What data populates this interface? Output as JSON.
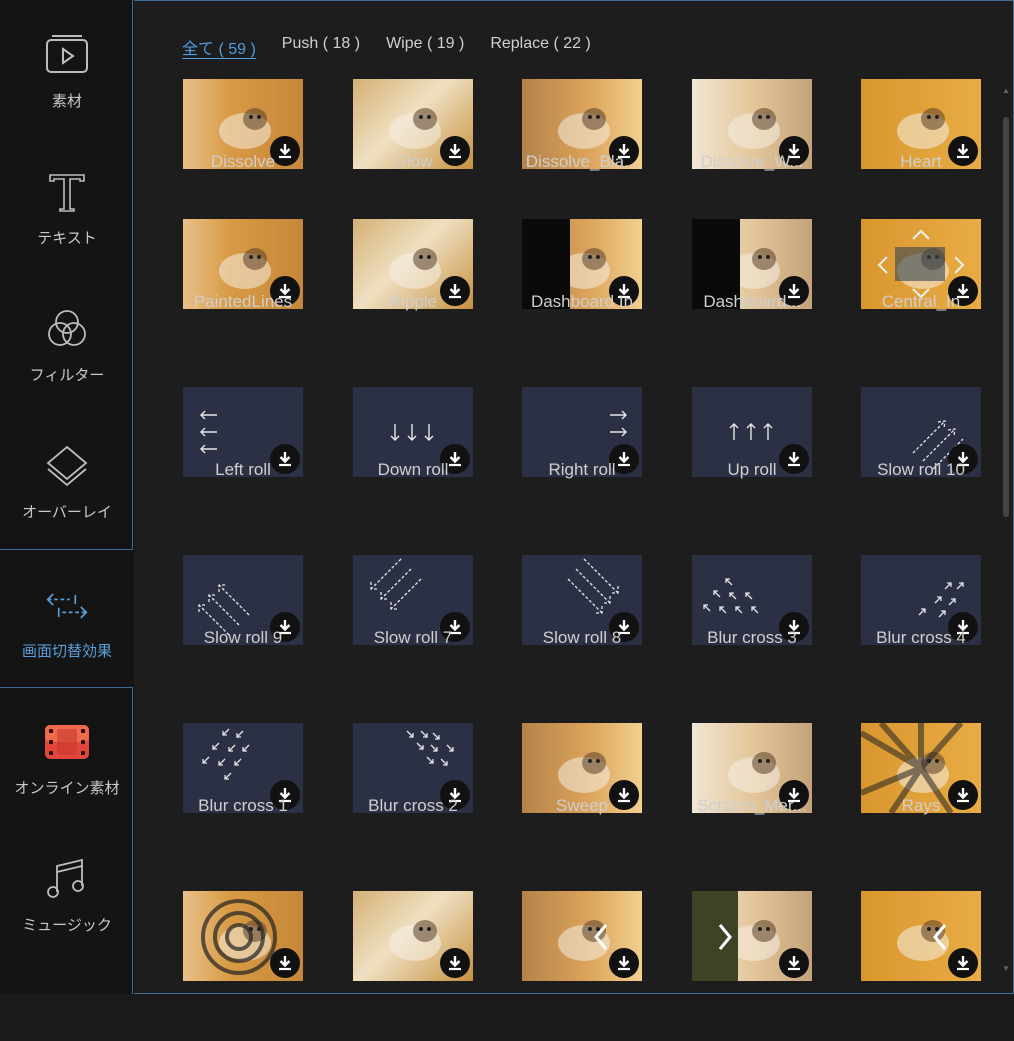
{
  "sidebar": {
    "items": [
      {
        "label": "素材",
        "icon": "media-icon"
      },
      {
        "label": "テキスト",
        "icon": "text-icon"
      },
      {
        "label": "フィルター",
        "icon": "filter-icon"
      },
      {
        "label": "オーバーレイ",
        "icon": "overlay-icon"
      },
      {
        "label": "画面切替効果",
        "icon": "transition-icon"
      },
      {
        "label": "オンライン素材",
        "icon": "online-media-icon"
      },
      {
        "label": "ミュージック",
        "icon": "music-icon"
      }
    ]
  },
  "tabs": [
    {
      "label": "全て ( 59 )"
    },
    {
      "label": "Push ( 18 )"
    },
    {
      "label": "Wipe ( 19 )"
    },
    {
      "label": "Replace ( 22 )"
    }
  ],
  "transitions": [
    {
      "name": "Dissolve"
    },
    {
      "name": "Glow"
    },
    {
      "name": "Dissolve_Bla..."
    },
    {
      "name": "Dissolve_W..."
    },
    {
      "name": "Heart"
    },
    {
      "name": "PaintedLines"
    },
    {
      "name": "Ripple"
    },
    {
      "name": "Dashboard In"
    },
    {
      "name": "Dashboard..."
    },
    {
      "name": "Central_In"
    },
    {
      "name": "Left roll"
    },
    {
      "name": "Down roll"
    },
    {
      "name": "Right roll"
    },
    {
      "name": "Up roll"
    },
    {
      "name": "Slow roll 10"
    },
    {
      "name": "Slow roll 9"
    },
    {
      "name": "Slow roll 7"
    },
    {
      "name": "Slow roll 8"
    },
    {
      "name": "Blur cross 3"
    },
    {
      "name": "Blur cross 4"
    },
    {
      "name": "Blur cross 1"
    },
    {
      "name": "Blur cross 2"
    },
    {
      "name": "Sweep"
    },
    {
      "name": "Scratch_Mer..."
    },
    {
      "name": "Rays"
    },
    {
      "name": ""
    },
    {
      "name": ""
    },
    {
      "name": ""
    },
    {
      "name": ""
    },
    {
      "name": ""
    }
  ],
  "colors": {
    "accent": "#4e9de0",
    "frame": "#3d6d96",
    "thumb_dark": "#2c3044",
    "photo_orange": "#e2a040",
    "download_bg": "#111111"
  }
}
